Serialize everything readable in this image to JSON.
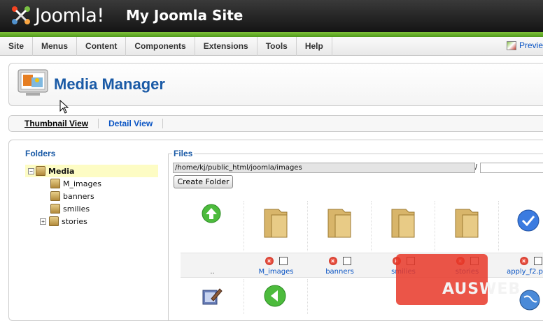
{
  "header": {
    "logo_text": "Joomla!",
    "site_title": "My Joomla Site"
  },
  "menu": {
    "items": [
      "Site",
      "Menus",
      "Content",
      "Components",
      "Extensions",
      "Tools",
      "Help"
    ],
    "preview_label": "Previe"
  },
  "page": {
    "title": "Media Manager"
  },
  "views": {
    "thumbnail": "Thumbnail View",
    "detail": "Detail View"
  },
  "folders": {
    "heading": "Folders",
    "tree": [
      {
        "label": "Media",
        "expander": "−"
      },
      {
        "label": "M_images"
      },
      {
        "label": "banners"
      },
      {
        "label": "smilies"
      },
      {
        "label": "stories",
        "expander": "+"
      }
    ]
  },
  "files": {
    "heading": "Files",
    "path": "/home/kj/public_html/joomla/images",
    "path_separator": "/",
    "new_folder_value": "",
    "create_folder_label": "Create Folder",
    "items": [
      {
        "label": "..",
        "kind": "up"
      },
      {
        "label": "M_images",
        "kind": "folder"
      },
      {
        "label": "banners",
        "kind": "folder"
      },
      {
        "label": "smilies",
        "kind": "folder"
      },
      {
        "label": "stories",
        "kind": "folder"
      },
      {
        "label": "apply_f2.p",
        "kind": "image"
      }
    ]
  },
  "watermark": {
    "text": "AUSWEB"
  },
  "colors": {
    "accent_blue": "#1a5aa6",
    "green_bar": "#6cb02a",
    "watermark_red": "#e83728"
  }
}
